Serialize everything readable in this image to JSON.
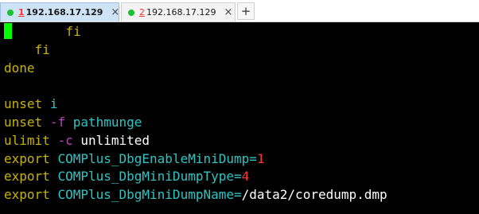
{
  "tabs": [
    {
      "number": "1",
      "title": "192.168.17.129",
      "active": true,
      "status_color": "#19c232"
    },
    {
      "number": "2",
      "title": "192.168.17.129",
      "active": false,
      "status_color": "#19c232"
    }
  ],
  "new_tab_label": "+",
  "close_glyph": "×",
  "colors": {
    "keyword": "#c8b400",
    "variable": "#2ec4c4",
    "option": "#c040c0",
    "number": "#ff3030",
    "cursor": "#00ff00",
    "background": "#000000"
  },
  "terminal": {
    "lines": [
      {
        "indent": "       ",
        "kw": "fi"
      },
      {
        "indent": "    ",
        "kw": "fi"
      },
      {
        "kw": "done"
      },
      {
        "blank": ""
      },
      {
        "kw": "unset",
        "sp": " ",
        "var": "i"
      },
      {
        "kw": "unset",
        "sp": " ",
        "opt": "-f",
        "sp2": " ",
        "var": "pathmunge"
      },
      {
        "kw": "ulimit",
        "sp": " ",
        "opt": "-c",
        "sp2": " ",
        "plain": "unlimited"
      },
      {
        "kw": "export",
        "sp": " ",
        "var": "COMPlus_DbgEnableMiniDump=",
        "num": "1"
      },
      {
        "kw": "export",
        "sp": " ",
        "var": "COMPlus_DbgMiniDumpType=",
        "num": "4"
      },
      {
        "kw": "export",
        "sp": " ",
        "var": "COMPlus_DbgMiniDumpName=",
        "plain": "/data2/coredump.dmp"
      }
    ]
  }
}
